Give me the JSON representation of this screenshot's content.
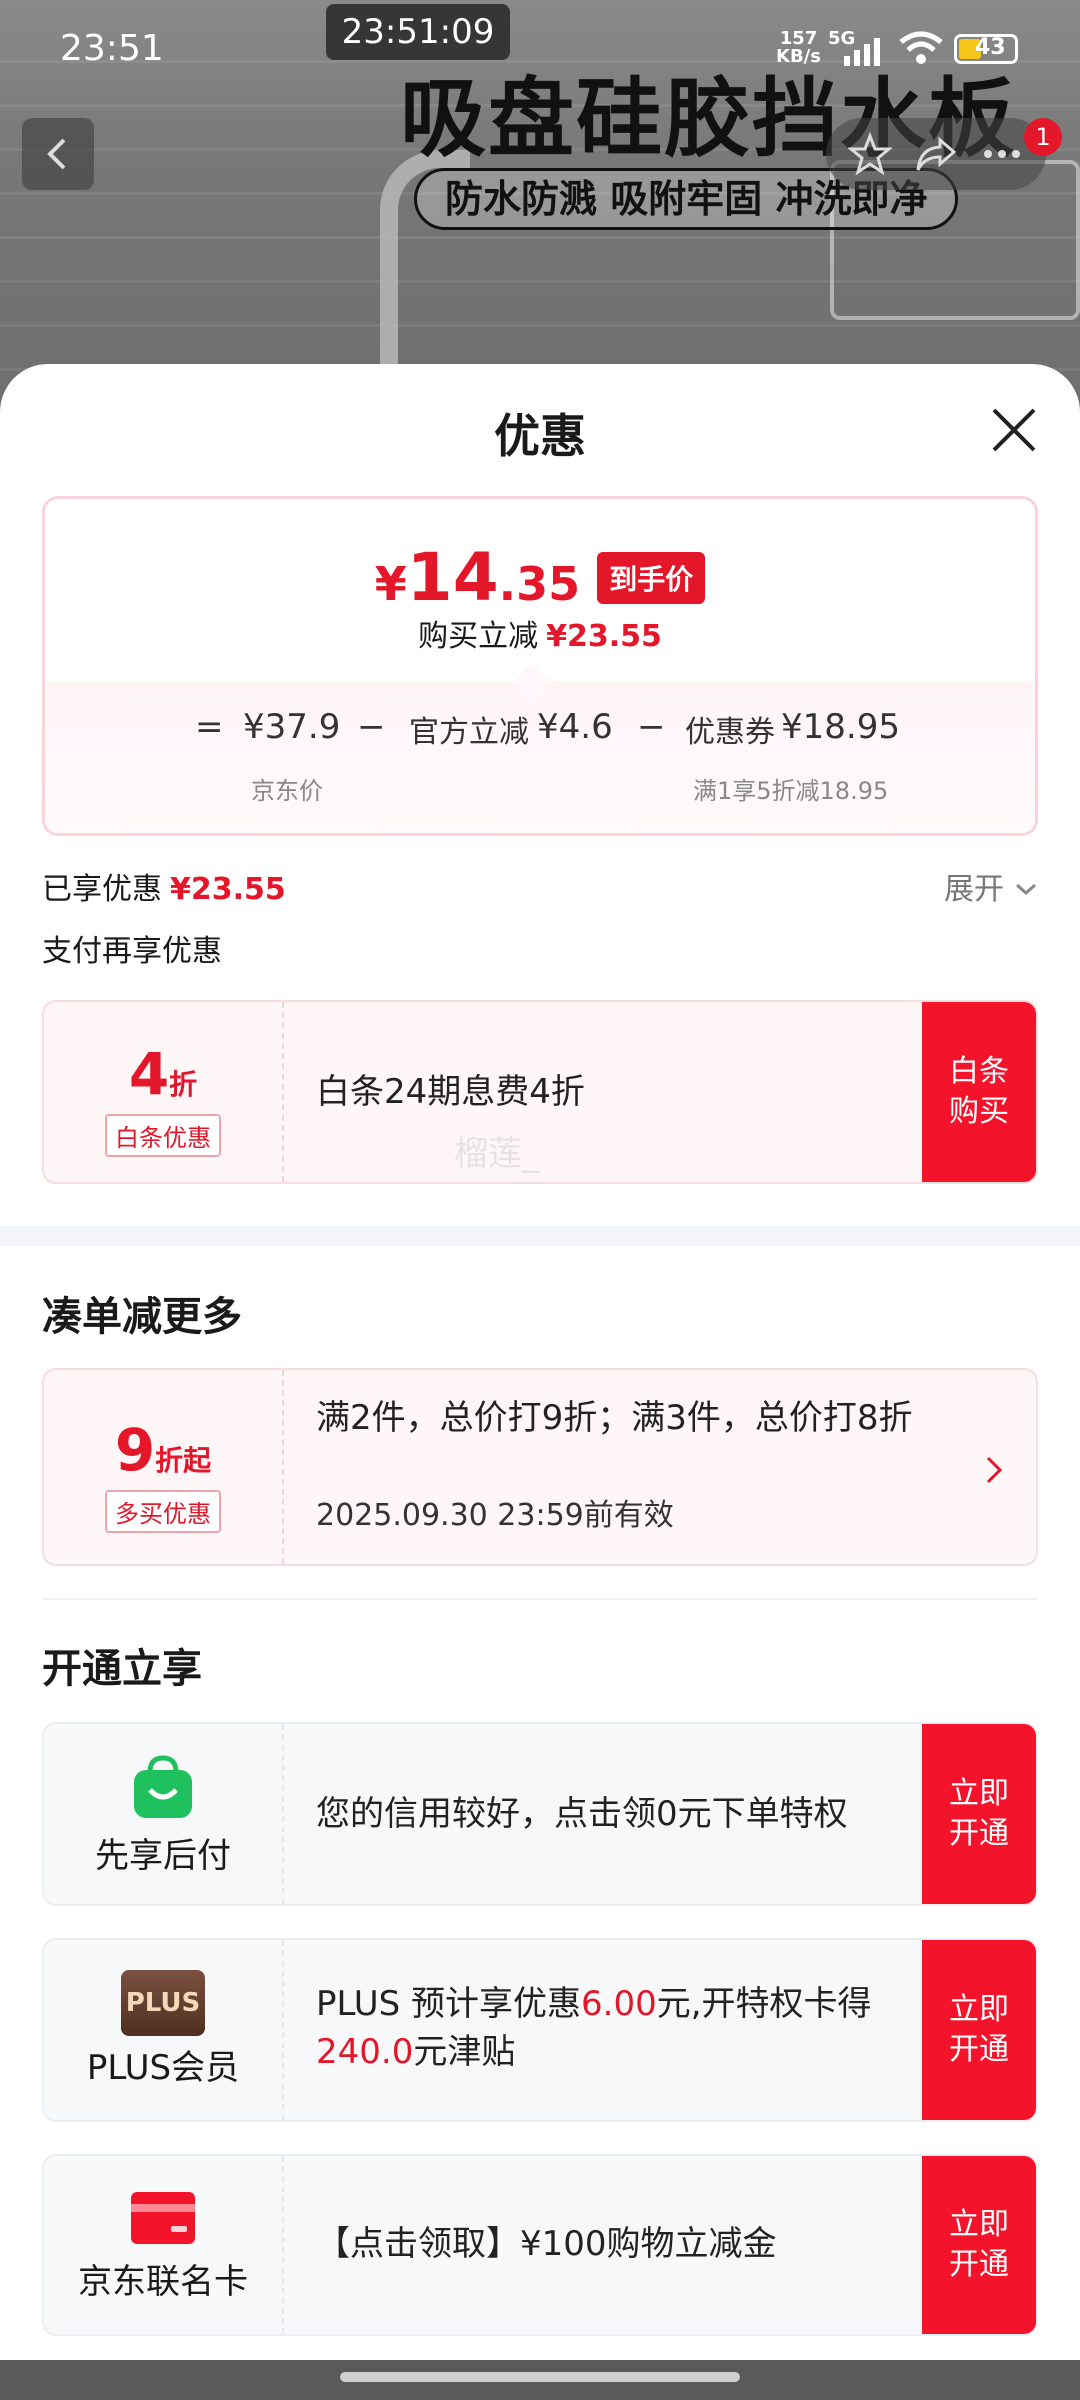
{
  "status_bar": {
    "time": "23:51",
    "floating_time": "23:51:09",
    "net_speed_value": "157",
    "net_speed_unit": "KB/s",
    "network": "5G",
    "battery": "43"
  },
  "background": {
    "headline": "吸盘硅胶挡水板",
    "tagline": "防水防溅 吸附牢固 冲洗即净",
    "notification_count": "1"
  },
  "sheet": {
    "title": "优惠",
    "price": {
      "currency": "¥",
      "integer": "14",
      "decimal": ".35",
      "tag": "到手价",
      "reduce_label": "购买立减",
      "reduce_value": "¥23.55"
    },
    "formula": {
      "equals": "=",
      "base_price": "¥37.9",
      "base_label": "京东价",
      "minus1": "−",
      "official_label": "官方立减",
      "official_value": "¥4.6",
      "minus2": "−",
      "coupon_label": "优惠券",
      "coupon_value": "¥18.95",
      "coupon_note": "满1享5折减18.95"
    },
    "enjoyed_label": "已享优惠",
    "enjoyed_value": "¥23.55",
    "expand_label": "展开",
    "pay_more_label": "支付再享优惠",
    "watermark": "榴莲_",
    "baitiao": {
      "discount_num": "4",
      "discount_unit": "折",
      "tag": "白条优惠",
      "desc": "白条24期息费4折",
      "button": "白条购买"
    },
    "bundle_section_title": "凑单减更多",
    "bundle": {
      "discount_num": "9",
      "discount_unit": "折起",
      "tag": "多买优惠",
      "desc": "满2件，总价打9折；满3件，总价打8折",
      "valid": "2025.09.30 23:59前有效"
    },
    "open_section_title": "开通立享",
    "open_items": [
      {
        "label": "先享后付",
        "icon": "shopping-bag-icon",
        "desc": "您的信用较好，点击领0元下单特权",
        "button": "立即开通"
      },
      {
        "label": "PLUS会员",
        "icon_text": "PLUS",
        "desc_prefix": "PLUS 预计享优惠",
        "desc_highlight1": "6.00",
        "desc_middle": "元,开特权卡得",
        "desc_highlight2": "240.0",
        "desc_suffix": "元津贴",
        "button": "立即开通"
      },
      {
        "label": "京东联名卡",
        "icon": "credit-card-icon",
        "desc": "【点击领取】¥100购物立减金",
        "button": "立即开通"
      }
    ],
    "colors": {
      "accent_red": "#e4162a",
      "button_red": "#f3142b",
      "green": "#1ec15d",
      "plus_brown": "#6b4431"
    }
  }
}
